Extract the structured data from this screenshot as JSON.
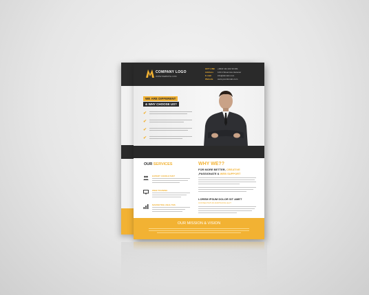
{
  "flyer": {
    "logo": {
      "name": "COMPANY LOGO",
      "tagline": "WWW.WEBSITE.COM"
    },
    "contact": [
      {
        "key": "HOT LINE",
        "value": "+0022 111 222 33 001"
      },
      {
        "key": "Address",
        "value": "123 A Street Ave Hanover"
      },
      {
        "key": "E-mail",
        "value": "info@domain.com"
      },
      {
        "key": "Website",
        "value": "www.yourdomain.com"
      }
    ],
    "hero": {
      "tag1": "WE ARE DIFFERENT",
      "tag2": "& WHY CHOOSE US?"
    },
    "services": {
      "title_part1": "OUR ",
      "title_part2": "SERVICES",
      "items": [
        {
          "name": "EXPERT CONSULTANT",
          "icon": "people-icon"
        },
        {
          "name": "WEB TRAINING",
          "icon": "monitor-icon"
        },
        {
          "name": "MARKETING ANALYSIS",
          "icon": "chart-icon"
        }
      ]
    },
    "why": {
      "title": "WHY WE??",
      "sub_part1": "FOR MORE BETTER, ",
      "sub_part2": "CREATIVE",
      "sub_part3": " ,PASSIONATE & ",
      "sub_part4": "WEB SUPPORT",
      "lorem_title": "LOREM IPSUM DOLOR SIT AMET",
      "lorem_sub": "CONSECTETUR ADIPISCING ELIT"
    },
    "footer": {
      "mission": "OUR MISSION & VISION"
    }
  },
  "colors": {
    "accent": "#f2b233",
    "dark": "#2a2a2a"
  }
}
